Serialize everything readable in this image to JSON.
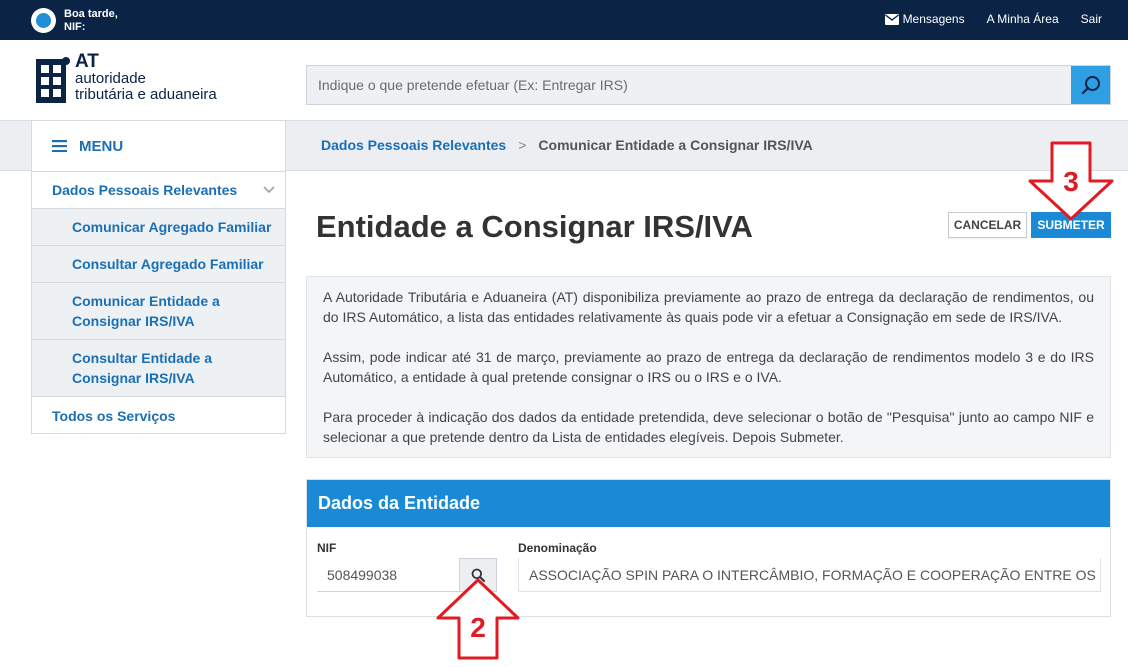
{
  "topbar": {
    "greeting_line1": "Boa tarde,",
    "greeting_line2": "NIF:",
    "nav": [
      {
        "label": "Mensagens",
        "icon": "envelope-icon"
      },
      {
        "label": "A Minha Área"
      },
      {
        "label": "Sair"
      }
    ]
  },
  "logo": {
    "abbr": "AT",
    "line1": "autoridade",
    "line2": "tributária e aduaneira"
  },
  "search": {
    "placeholder": "Indique o que pretende efetuar (Ex: Entregar IRS)",
    "icon": "search-icon"
  },
  "sidebar": {
    "menu_label": "MENU",
    "section": "Dados Pessoais Relevantes",
    "items": [
      {
        "label": "Comunicar Agregado Familiar"
      },
      {
        "label": "Consultar Agregado Familiar"
      },
      {
        "label": "Comunicar Entidade a Consignar IRS/IVA"
      },
      {
        "label": "Consultar Entidade a Consignar IRS/IVA"
      }
    ],
    "all_services": "Todos os Serviços"
  },
  "breadcrumb": {
    "parent": "Dados Pessoais Relevantes",
    "separator": ">",
    "current": "Comunicar Entidade a Consignar IRS/IVA"
  },
  "page": {
    "title": "Entidade a Consignar IRS/IVA",
    "cancel_label": "CANCELAR",
    "submit_label": "SUBMETER"
  },
  "info": {
    "p1": "A Autoridade Tributária e Aduaneira (AT) disponibiliza previamente ao prazo de entrega da declaração de rendimentos, ou do IRS Automático, a lista das entidades relativamente às quais pode vir a efetuar a Consignação em sede de IRS/IVA.",
    "p2": "Assim, pode indicar até 31 de março, previamente ao prazo de entrega da declaração de rendimentos modelo 3 e do IRS Automático, a entidade à qual pretende consignar o IRS ou o IRS e o IVA.",
    "p3": "Para proceder à indicação dos dados da entidade pretendida, deve selecionar o botão de \"Pesquisa\" junto ao campo NIF e selecionar a que pretende dentro da Lista de entidades elegíveis. Depois Submeter."
  },
  "entity": {
    "header": "Dados da Entidade",
    "nif_label": "NIF",
    "nif_value": "508499038",
    "name_label": "Denominação",
    "name_value": "ASSOCIAÇÃO SPIN PARA O INTERCÂMBIO, FORMAÇÃO E COOPERAÇÃO ENTRE OS POVOS"
  },
  "annotations": [
    {
      "number": "2",
      "color": "#e01b24",
      "direction": "up"
    },
    {
      "number": "3",
      "color": "#e01b24",
      "direction": "down"
    }
  ],
  "colors": {
    "topbar": "#0b2345",
    "accent": "#1a8ad6",
    "link": "#1a6fb5",
    "annotation": "#e01b24"
  }
}
